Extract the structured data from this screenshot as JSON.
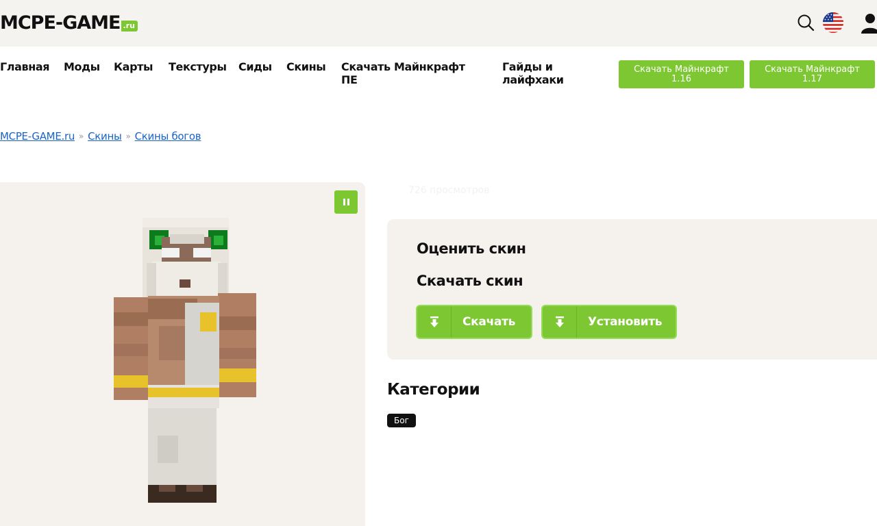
{
  "header": {
    "logo_text": "MCPE-GAME",
    "logo_tld": ".ru",
    "icons": [
      "search-icon",
      "us-flag-icon",
      "user-icon"
    ]
  },
  "nav": {
    "items": [
      {
        "label": "Главная"
      },
      {
        "label": "Моды"
      },
      {
        "label": "Карты"
      },
      {
        "label": "Текстуры"
      },
      {
        "label": "Сиды"
      },
      {
        "label": "Скины"
      },
      {
        "label_line1": "Скачать Майнкрафт",
        "label_line2": "ПЕ"
      },
      {
        "label_line1": "Гайды и",
        "label_line2": "лайфхаки"
      }
    ],
    "download_buttons": [
      {
        "line1": "Скачать Майнкрафт",
        "line2": "1.16"
      },
      {
        "line1": "Скачать Майнкрафт",
        "line2": "1.17"
      }
    ]
  },
  "breadcrumb": {
    "items": [
      "MCPE-GAME.ru",
      "Скины",
      "Скины богов"
    ],
    "separator": "»"
  },
  "skin": {
    "views": "726 просмотров"
  },
  "panel": {
    "rate_title": "Оценить скин",
    "download_title": "Скачать скин",
    "download_button": "Скачать",
    "install_button": "Установить"
  },
  "categories": {
    "title": "Категории",
    "tags": [
      "Бог"
    ]
  },
  "colors": {
    "accent": "#7dc832",
    "link": "#1a63c9",
    "panel_bg": "#f5f2ee",
    "header_bg": "#f5f3f0"
  }
}
